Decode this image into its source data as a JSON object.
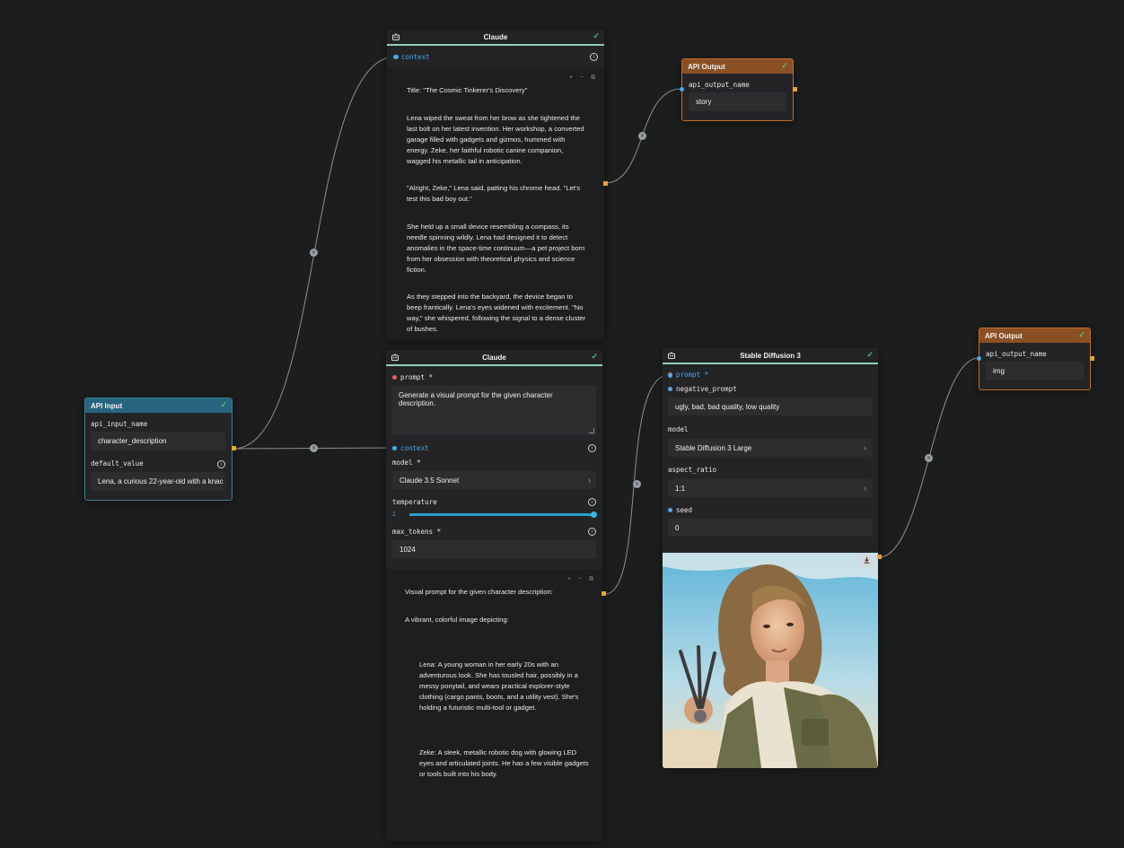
{
  "claude_top": {
    "title": "Claude",
    "context_label": "context",
    "output_paragraphs": [
      "Title: \"The Cosmic Tinkerer's Discovery\"",
      "Lena wiped the sweat from her brow as she tightened the last bolt on her latest invention. Her workshop, a converted garage filled with gadgets and gizmos, hummed with energy. Zeke, her faithful robotic canine companion, wagged his metallic tail in anticipation.",
      "\"Alright, Zeke,\" Lena said, patting his chrome head. \"Let's test this bad boy out.\"",
      "She held up a small device resembling a compass, its needle spinning wildly. Lena had designed it to detect anomalies in the space-time continuum—a pet project born from her obsession with theoretical physics and science fiction.",
      "As they stepped into the backyard, the device began to beep frantically. Lena's eyes widened with excitement. \"No way,\" she whispered, following the signal to a dense cluster of bushes."
    ]
  },
  "api_output_story": {
    "title": "API Output",
    "field_label": "api_output_name",
    "value": "story"
  },
  "api_output_img": {
    "title": "API Output",
    "field_label": "api_output_name",
    "value": "img"
  },
  "api_input": {
    "title": "API Input",
    "name_label": "api_input_name",
    "name_value": "character_description",
    "default_label": "default_value",
    "default_value": "Lena, a curious 22-year-old with a knac"
  },
  "claude_mid": {
    "title": "Claude",
    "prompt_label": "prompt",
    "prompt_value": "Generate a visual prompt for the given character description.",
    "context_label": "context",
    "model_label": "model",
    "model_value": "Claude 3.5 Sonnet",
    "temperature_label": "temperature",
    "temperature_value": "1",
    "temperature_fraction": 1.0,
    "max_tokens_label": "max_tokens",
    "max_tokens_value": "1024",
    "required_mark": "*",
    "output_paragraphs": [
      "Visual prompt for the given character description:",
      "A vibrant, colorful image depicting:",
      "Lena: A young woman in her early 20s with an adventurous look. She has tousled hair, possibly in a messy ponytail, and wears practical explorer-style clothing (cargo pants, boots, and a utility vest). She's holding a futuristic multi-tool or gadget.",
      "Zeke: A sleek, metallic robotic dog with glowing LED eyes and articulated joints. He has a few visible gadgets or tools built into his body."
    ]
  },
  "stable_diffusion": {
    "title": "Stable Diffusion 3",
    "prompt_label": "prompt",
    "negative_label": "negative_prompt",
    "negative_value": "ugly, bad, bad quality, low quality",
    "model_label": "model",
    "model_value": "Stable Diffusion 3 Large",
    "aspect_label": "aspect_ratio",
    "aspect_value": "1:1",
    "seed_label": "seed",
    "seed_value": "0",
    "required_mark": "*"
  },
  "icons": {
    "check": "✓",
    "chevron": "›",
    "info": "i",
    "disconnect": "×",
    "output_tools": "+ − ⧉"
  },
  "colors": {
    "canvas": "#1c1e1d",
    "node": "#242426",
    "api_output_header": "#8a5024",
    "api_input_header": "#27657f",
    "accent_blue": "#4aa8e8",
    "handle_orange": "#e8a23b",
    "check_green": "#52c27b"
  }
}
